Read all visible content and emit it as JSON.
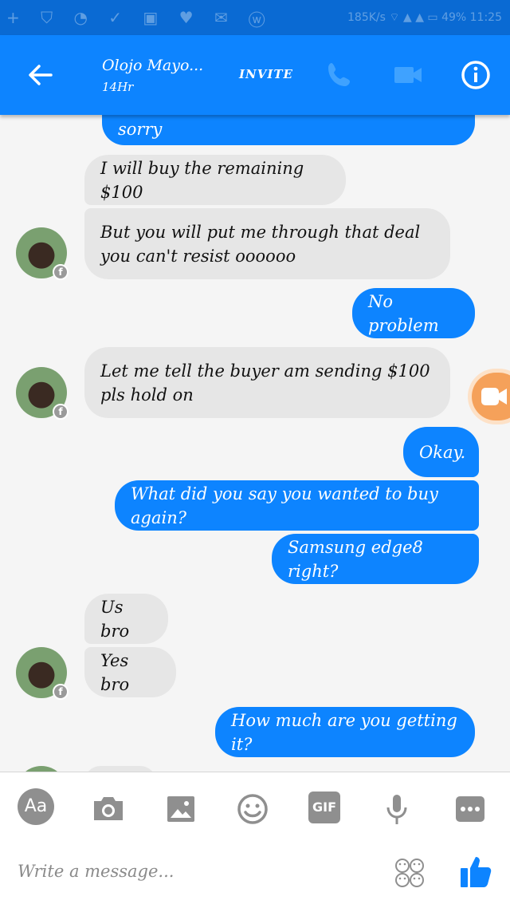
{
  "status_bar": {
    "left_icons": "+ ⛉ ◔ ✓ ▣ ♥ ✉ ⓦ",
    "right_text": "185K/s  ⌔  ▲ ▲ ▭ 49%  11:25"
  },
  "header": {
    "title": "Olojo Mayo...",
    "subtitle": "14Hr",
    "invite_label": "INVITE",
    "icons": [
      "back-arrow-icon",
      "phone-icon",
      "video-camera-icon",
      "info-icon"
    ]
  },
  "messages": [
    {
      "side": "out",
      "text": "sorry"
    },
    {
      "side": "in",
      "text": "I will buy the remaining $100"
    },
    {
      "side": "in",
      "text": "But you will put me through that deal you can't resist oooooo"
    },
    {
      "side": "out",
      "text": "No problem"
    },
    {
      "side": "in",
      "text": "Let me tell the buyer am sending $100 pls hold on"
    },
    {
      "side": "out",
      "text": "Okay."
    },
    {
      "side": "out",
      "text": "What did you say you wanted to buy again?"
    },
    {
      "side": "out",
      "text": "Samsung edge8 right?"
    },
    {
      "side": "in",
      "text": "Us bro"
    },
    {
      "side": "in",
      "text": "Yes bro"
    },
    {
      "side": "out",
      "text": "How much are you getting it?"
    }
  ],
  "composer": {
    "aa_label": "Aa",
    "gif_label": "GIF",
    "placeholder": "Write a message...",
    "icons": [
      "aa-icon",
      "camera-icon",
      "image-icon",
      "smiley-icon",
      "gif-icon",
      "microphone-icon",
      "more-icon",
      "stickers-icon",
      "thumbs-up-icon"
    ]
  },
  "colors": {
    "accent": "#0d84ff",
    "status_bar": "#0a6ad3",
    "incoming_bubble": "#e6e6e6",
    "icon_gray": "#8f8f8f"
  }
}
